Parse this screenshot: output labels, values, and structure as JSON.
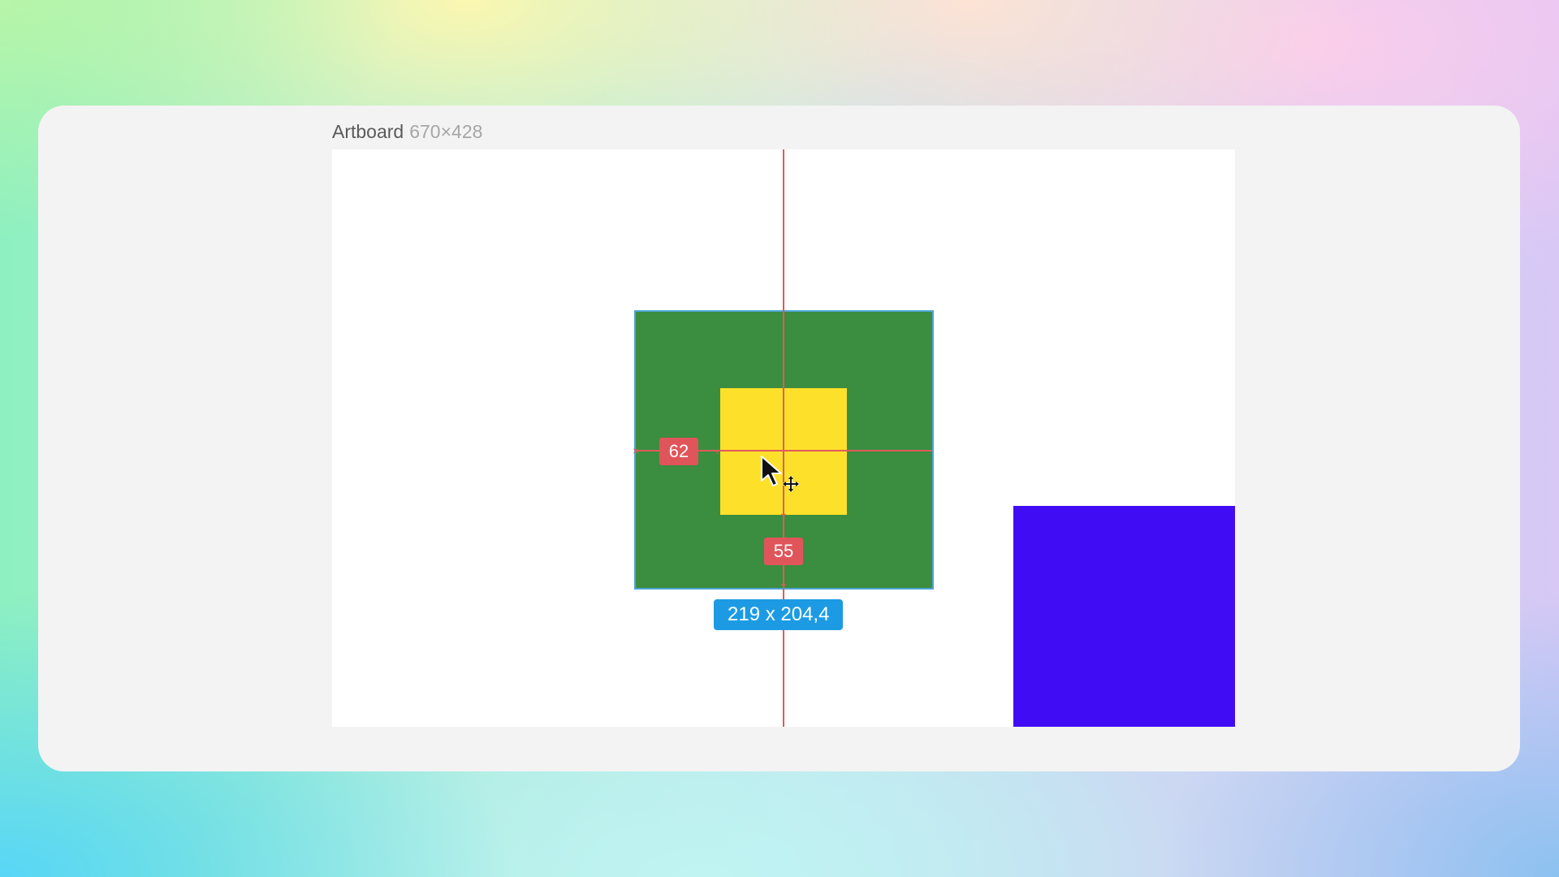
{
  "artboard": {
    "name": "Artboard",
    "dimensions": "670×428"
  },
  "shapes": {
    "outer": {
      "color": "#3b8d3f"
    },
    "inner": {
      "color": "#fde02a"
    },
    "side": {
      "color": "#400cf3"
    }
  },
  "measurements": {
    "left_gap": "62",
    "bottom_gap": "55",
    "selection_size": "219 x 204,4"
  },
  "colors": {
    "guide": "#e05a5c",
    "selection_outline": "#4fa6d6",
    "size_badge": "#1c9be4"
  },
  "cursor": {
    "icon": "move-cursor-icon"
  }
}
